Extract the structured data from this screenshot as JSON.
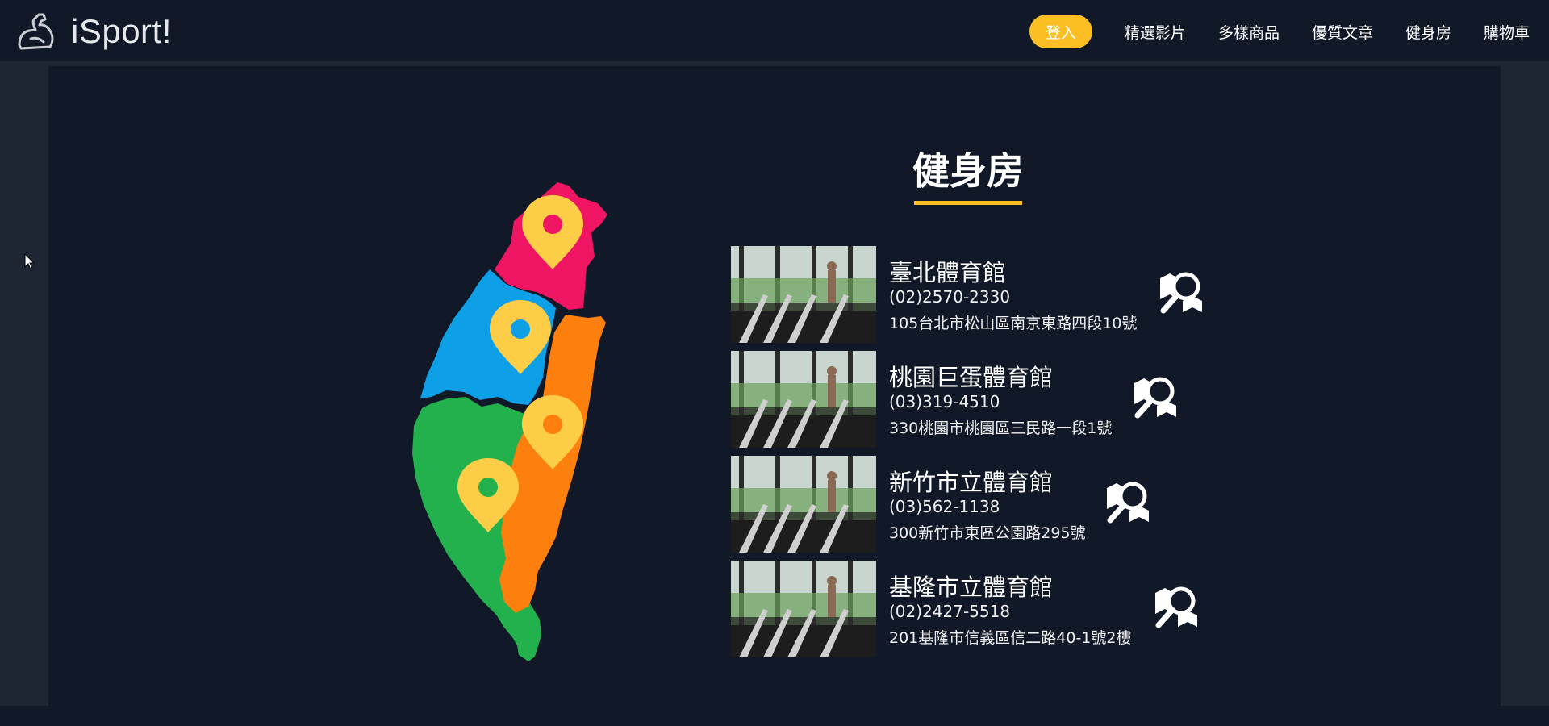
{
  "navbar": {
    "brand_name": "iSport!",
    "brand_icon": "flexed-arm-icon",
    "login_label": "登入",
    "links": [
      {
        "label": "精選影片"
      },
      {
        "label": "多樣商品"
      },
      {
        "label": "優質文章"
      },
      {
        "label": "健身房"
      },
      {
        "label": "購物車"
      }
    ]
  },
  "main": {
    "title": "健身房",
    "map_icon": "taiwan-map-icon",
    "map_region_colors": [
      "#ef1563",
      "#0ea0e6",
      "#22b14c",
      "#fd7f0e"
    ],
    "pin_color": "#fdcd47",
    "gyms": [
      {
        "name": "臺北體育館",
        "phone": "(02)2570-2330",
        "address": "105台北市松山區南京東路四段10號"
      },
      {
        "name": "桃園巨蛋體育館",
        "phone": "(03)319-4510",
        "address": "330桃園市桃園區三民路一段1號"
      },
      {
        "name": "新竹市立體育館",
        "phone": "(03)562-1138",
        "address": "300新竹市東區公園路295號"
      },
      {
        "name": "基隆市立體育館",
        "phone": "(02)2427-5518",
        "address": "201基隆市信義區信二路40-1號2樓"
      }
    ]
  },
  "colors": {
    "accent": "#fbbf24",
    "navbar_bg": "#111827",
    "page_bg": "#1e2633"
  }
}
